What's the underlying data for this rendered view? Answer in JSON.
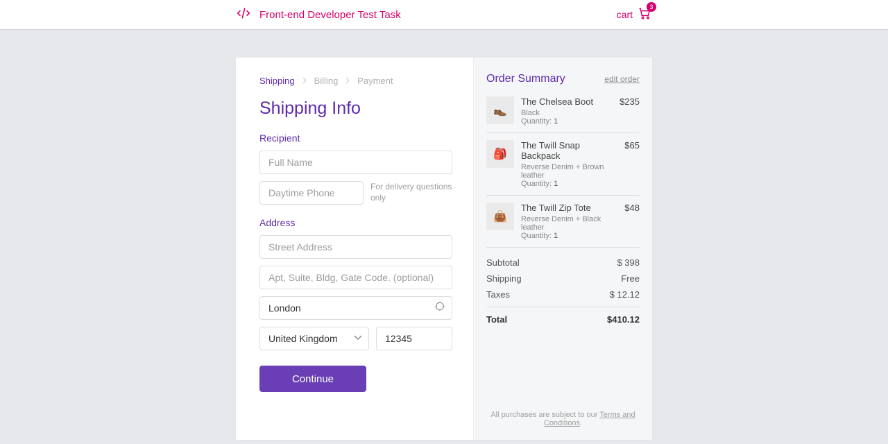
{
  "header": {
    "title": "Front-end Developer Test Task",
    "cart_label": "cart",
    "cart_count": "3"
  },
  "breadcrumbs": {
    "items": [
      "Shipping",
      "Billing",
      "Payment"
    ],
    "active_index": 0
  },
  "page": {
    "title": "Shipping Info",
    "recipient_label": "Recipient",
    "address_label": "Address",
    "continue_label": "Continue"
  },
  "fields": {
    "full_name": {
      "placeholder": "Full Name",
      "value": ""
    },
    "phone": {
      "placeholder": "Daytime Phone",
      "value": "",
      "hint": "For delivery questions only"
    },
    "street": {
      "placeholder": "Street Address",
      "value": ""
    },
    "apt": {
      "placeholder": "Apt, Suite, Bldg, Gate Code. (optional)",
      "value": ""
    },
    "city": {
      "placeholder": "",
      "value": "London"
    },
    "country": {
      "value": "United Kingdom"
    },
    "zip": {
      "placeholder": "",
      "value": "12345"
    }
  },
  "summary": {
    "title": "Order Summary",
    "edit_label": "edit order",
    "items": [
      {
        "name": "The Chelsea Boot",
        "desc": "Black",
        "qty_label": "Quantity:",
        "qty": "1",
        "price": "$235",
        "glyph": "👞"
      },
      {
        "name": "The Twill Snap Backpack",
        "desc": "Reverse Denim + Brown leather",
        "qty_label": "Quantity:",
        "qty": "1",
        "price": "$65",
        "glyph": "🎒"
      },
      {
        "name": "The Twill Zip Tote",
        "desc": "Reverse Denim + Black leather",
        "qty_label": "Quantity:",
        "qty": "1",
        "price": "$48",
        "glyph": "👜"
      }
    ],
    "totals": {
      "subtotal_label": "Subtotal",
      "subtotal": "$ 398",
      "shipping_label": "Shipping",
      "shipping": "Free",
      "taxes_label": "Taxes",
      "taxes": "$ 12.12",
      "total_label": "Total",
      "total": "$410.12"
    },
    "legal_prefix": "All purchases are subject to our ",
    "legal_link": "Terms and Conditions",
    "legal_suffix": "."
  }
}
